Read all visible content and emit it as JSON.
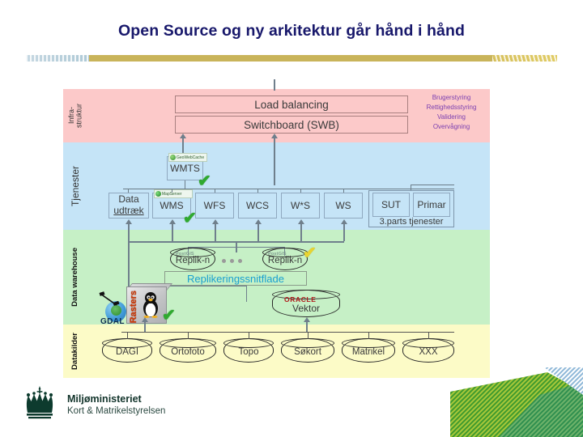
{
  "slide": {
    "title": "Open Source og ny arkitektur går hånd i hånd"
  },
  "diagram": {
    "bands": [
      {
        "id": "infra",
        "label": "Infra-\nstruktur",
        "color": "#fcc9c9"
      },
      {
        "id": "services",
        "label": "Tjenester",
        "color": "#c5e4f7"
      },
      {
        "id": "dwh",
        "label": "Data warehouse",
        "color": "#c6f0c6"
      },
      {
        "id": "sources",
        "label": "Datakilder",
        "color": "#fcfbc7"
      }
    ],
    "infrastructure": {
      "load_balancing": "Load balancing",
      "switchboard": "Switchboard (SWB)",
      "functions": [
        "Brugerstyring",
        "Rettighedsstyring",
        "Validering",
        "Overvågning"
      ],
      "functions_color": "#7b3fb0"
    },
    "services": {
      "wmts": "WMTS",
      "wmts_badge": "GeoWebCache",
      "data_extract_line1": "Data",
      "data_extract_line2": "udtræk",
      "wms": "WMS",
      "wms_badge": "MapServer",
      "items": [
        "WFS",
        "WCS",
        "W*S",
        "WS"
      ],
      "third_party": {
        "caption": "3.parts tjenester",
        "items": [
          "SUT",
          "Primar"
        ]
      }
    },
    "warehouse": {
      "replica_left": "Replik-n",
      "replica_right": "Replik-n",
      "replica_badge": "PostGIS",
      "interface_label": "Replikeringssnitflade",
      "interface_color": "#19a0d0",
      "raster_label": "Rasters",
      "gdal_label": "GDAL",
      "vector_label": "Vektor",
      "vector_brand": "ORACLE"
    },
    "sources": {
      "items": [
        "DAGI",
        "Ortofoto",
        "Topo",
        "Søkort",
        "Matrikel",
        "XXX"
      ]
    },
    "checkmark_glyph": "✔"
  },
  "footer": {
    "ministry": "Miljøministeriet",
    "agency": "Kort & Matrikelstyrelsen"
  }
}
